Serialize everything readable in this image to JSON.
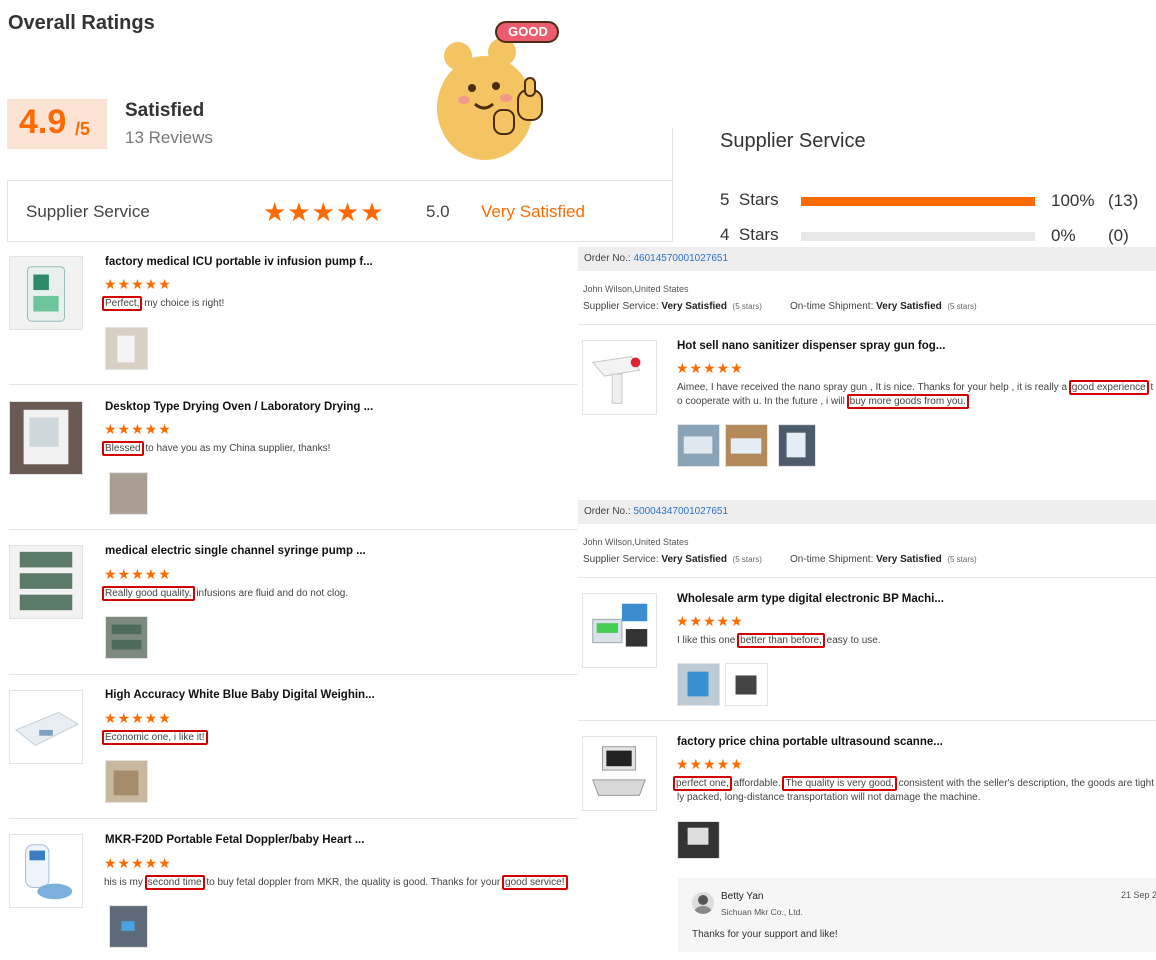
{
  "header": {
    "title": "Overall Ratings",
    "score_main": "4.9",
    "score_suffix": "/5",
    "satisfied_label": "Satisfied",
    "reviews_count": "13 Reviews",
    "sticker_text": "GOOD"
  },
  "supplier_bar": {
    "label": "Supplier Service",
    "score": "5.0",
    "verdict": "Very Satisfied",
    "stars": 5
  },
  "distribution": {
    "title": "Supplier Service",
    "rows": [
      {
        "label": "5  Stars",
        "fill": 1.0,
        "percent": "100%",
        "count": "(13)"
      },
      {
        "label": "4  Stars",
        "fill": 0.0,
        "percent": "0%",
        "count": "(0)"
      }
    ]
  },
  "left_reviews": [
    {
      "title": "factory medical ICU portable iv infusion pump f...",
      "hl1": "Perfect,",
      "rest": " my choice is right!"
    },
    {
      "title": "Desktop Type Drying Oven / Laboratory Drying ...",
      "hl1": "Blessed",
      "rest": " to have you as my China supplier, thanks!"
    },
    {
      "title": "medical electric single channel syringe pump ...",
      "hl1": "Really good quality,",
      "rest": " infusions are fluid and do not clog."
    },
    {
      "title": "High Accuracy White Blue Baby Digital Weighin...",
      "hl1": "Economic one, i like it!",
      "rest": ""
    },
    {
      "title": "MKR-F20D Portable Fetal Doppler/baby Heart ...",
      "pre": "his is my ",
      "hl1": "second time",
      "mid": " to buy fetal doppler from MKR, the quality is good. Thanks for your ",
      "hl2": "good service!"
    }
  ],
  "orders": [
    {
      "order_label": "Order No.:",
      "order_no": "46014570001027651",
      "buyer": "John Wilson,United States",
      "svc_label": "Supplier Service:",
      "svc_value": "Very Satisfied",
      "svc_stars": "(5 stars)",
      "ship_label": "On-time Shipment:",
      "ship_value": "Very Satisfied",
      "ship_stars": "(5 stars)"
    },
    {
      "order_label": "Order No.:",
      "order_no": "50004347001027651",
      "buyer": "John Wilson,United States",
      "svc_label": "Supplier Service:",
      "svc_value": "Very Satisfied",
      "svc_stars": "(5 stars)",
      "ship_label": "On-time Shipment:",
      "ship_value": "Very Satisfied",
      "ship_stars": "(5 stars)"
    }
  ],
  "right_reviews": [
    {
      "title": "Hot sell nano sanitizer dispenser spray gun fog...",
      "line1_pre": "Aimee,     I have received the nano spray gun , It is nice. Thanks for your help , it is really a ",
      "line1_hl": "good experience",
      "line1_post": " t",
      "line2_pre": "o cooperate with u. In the future , i will ",
      "line2_hl": "buy more goods from you."
    },
    {
      "title": "Wholesale arm type digital electronic BP Machi...",
      "pre": "I like this one ",
      "hl": "better than before,",
      "post": " easy to use."
    },
    {
      "title": "factory price china portable ultrasound scanne...",
      "hl1": "perfect one,",
      "mid": " affordable. ",
      "hl2": "The quality is very good,",
      "post": " consistent with the seller's description, the goods are tight",
      "line2": "ly packed, long-distance transportation will not damage the machine."
    }
  ],
  "reply": {
    "name": "Betty Yan",
    "company": "Sichuan Mkr Co., Ltd.",
    "date": "21 Sep 2",
    "text": "Thanks for your support and like!"
  },
  "colors": {
    "accent": "#ff6a00",
    "highlight": "#d40000",
    "link": "#2a72c4"
  }
}
